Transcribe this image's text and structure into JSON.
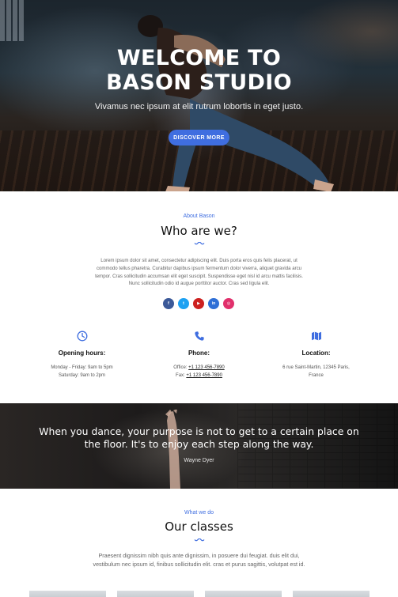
{
  "hero": {
    "title_line1": "WELCOME TO",
    "title_line2": "BASON STUDIO",
    "subtitle": "Vivamus nec ipsum at elit rutrum lobortis in eget justo.",
    "button_label": "DISCOVER MORE"
  },
  "about": {
    "eyebrow": "About Bason",
    "heading": "Who are we?",
    "body_lines": [
      "Lorem ipsum dolor sit amet, consectetur adipiscing elit. Duis porta eros quis felis placerat, ut",
      "commodo tellus pharetra. Curabitur dapibus ipsum fermentum dolor viverra, aliquet gravida arcu",
      "tempor. Cras sollicitudin accumsan elit eget suscipit. Suspendisse eget nisl id arcu mattis facilisis.",
      "Nunc sollicitudin odio id augue porttitor auctor. Cras sed ligula elit."
    ],
    "socials": [
      {
        "icon": "facebook-icon",
        "glyph": "f",
        "color": "#3b5998"
      },
      {
        "icon": "twitter-icon",
        "glyph": "t",
        "color": "#1da1f2"
      },
      {
        "icon": "youtube-icon",
        "glyph": "▶",
        "color": "#cd201f"
      },
      {
        "icon": "linkedin-icon",
        "glyph": "in",
        "color": "#2f6fd6"
      },
      {
        "icon": "instagram-icon",
        "glyph": "◎",
        "color": "#e1306c"
      }
    ]
  },
  "info": {
    "hours": {
      "icon": "clock-icon",
      "label": "Opening hours:",
      "line1": "Monday - Friday: 9am to 5pm",
      "line2": "Saturday: 9am to 2pm"
    },
    "phone": {
      "icon": "phone-icon",
      "label": "Phone:",
      "office_prefix": "Office: ",
      "office_number": "+1 123 456-7890",
      "fax_prefix": "Fax: ",
      "fax_number": "+1 123 456-7890"
    },
    "location": {
      "icon": "map-icon",
      "label": "Location:",
      "line1": "6 rue Saint-Martin, 12345 Paris,",
      "line2": "France"
    }
  },
  "quote": {
    "line1": "When you dance, your purpose is not to get to a certain place on",
    "line2": "the floor. It's to enjoy each step along the way.",
    "author": "Wayne Dyer"
  },
  "classes": {
    "eyebrow": "What we do",
    "heading": "Our classes",
    "body_line1": "Praesent dignissim nibh quis ante dignissim, in posuere dui feugiat. duis elit dui,",
    "body_line2": "vestibulum nec ipsum id, finibus sollicitudin elit. cras et purus sagittis, volutpat est id."
  },
  "colors": {
    "accent": "#3f6ee0"
  }
}
